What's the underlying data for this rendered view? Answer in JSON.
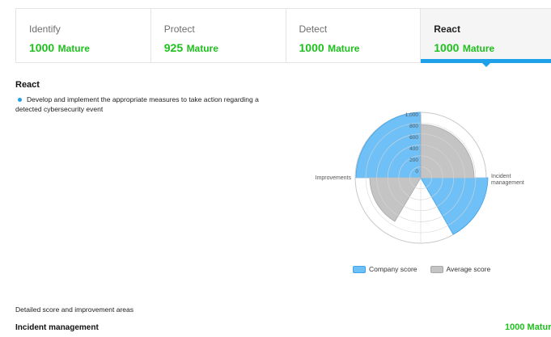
{
  "tabs": [
    {
      "name": "Identify",
      "score": "1000",
      "level": "Mature"
    },
    {
      "name": "Protect",
      "score": "925",
      "level": "Mature"
    },
    {
      "name": "Detect",
      "score": "1000",
      "level": "Mature"
    },
    {
      "name": "React",
      "score": "1000",
      "level": "Mature"
    }
  ],
  "active_tab": "React",
  "section": {
    "title": "React",
    "description": "Develop and implement the appropriate measures to take action regarding a detected cybersecurity event"
  },
  "chart_data": {
    "type": "radar",
    "axes": [
      "Improvements",
      "Incident management"
    ],
    "radial_ticks": [
      "1,000",
      "800",
      "600",
      "400",
      "200",
      "0"
    ],
    "rlim": [
      0,
      1000
    ],
    "series": [
      {
        "name": "Company score",
        "color": "#6ec0f7"
      },
      {
        "name": "Average score",
        "color": "#c4c4c4"
      }
    ],
    "legend_position": "bottom"
  },
  "legend": {
    "company": "Company score",
    "average": "Average score"
  },
  "details": {
    "label": "Detailed score and improvement areas",
    "area_title": "Incident management",
    "area_score": "1000 Matur"
  }
}
